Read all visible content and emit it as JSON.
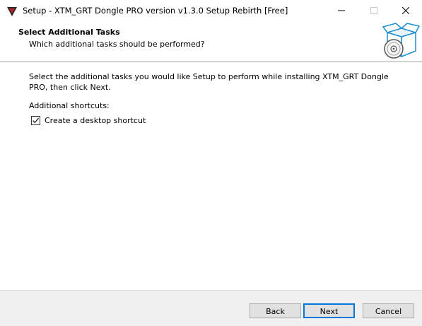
{
  "window": {
    "title": "Setup - XTM_GRT Dongle PRO version v1.3.0 Setup Rebirth [Free]",
    "controls": {
      "minimize": "minimize-icon",
      "maximize": "maximize-icon",
      "close": "close-icon"
    }
  },
  "header": {
    "title": "Select Additional Tasks",
    "subtitle": "Which additional tasks should be performed?",
    "icon": "setup-box-disc-icon"
  },
  "content": {
    "description": "Select the additional tasks you would like Setup to perform while installing XTM_GRT Dongle PRO, then click Next.",
    "section_label": "Additional shortcuts:",
    "tasks": [
      {
        "label": "Create a desktop shortcut",
        "checked": true
      }
    ]
  },
  "buttons": {
    "back": "Back",
    "next": "Next",
    "cancel": "Cancel"
  },
  "colors": {
    "accent": "#0078d7",
    "footer_bg": "#f0f0f0"
  }
}
